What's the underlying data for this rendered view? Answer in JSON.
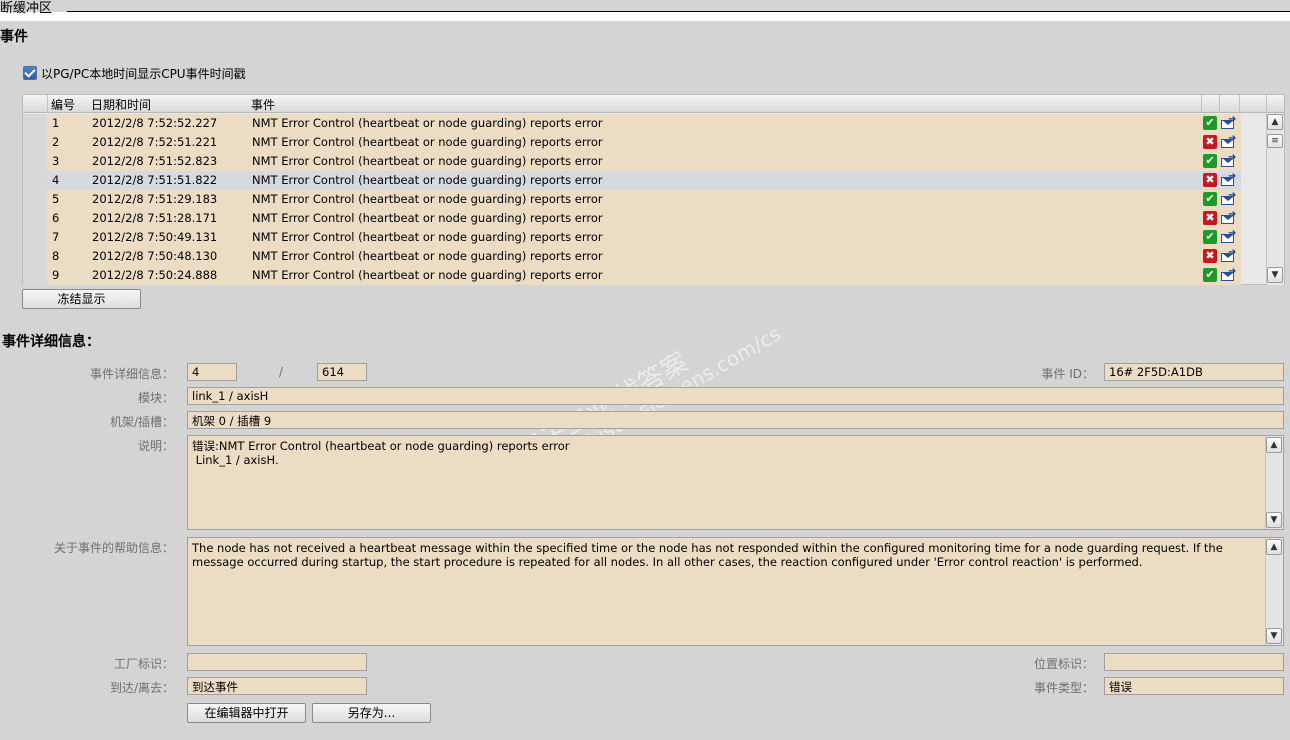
{
  "buffer": {
    "title": "断缓冲区"
  },
  "events": {
    "title": "事件",
    "checkbox_label": "以PG/PC本地时间显示CPU事件时间戳",
    "checkbox_checked": true,
    "columns": [
      "编号",
      "日期和时间",
      "事件"
    ],
    "rows": [
      {
        "no": "1",
        "time": "2012/2/8 7:52:52.227",
        "event": "NMT Error Control (heartbeat or node guarding) reports error",
        "status": "ok"
      },
      {
        "no": "2",
        "time": "2012/2/8 7:52:51.221",
        "event": "NMT Error Control (heartbeat or node guarding) reports error",
        "status": "error"
      },
      {
        "no": "3",
        "time": "2012/2/8 7:51:52.823",
        "event": "NMT Error Control (heartbeat or node guarding) reports error",
        "status": "ok"
      },
      {
        "no": "4",
        "time": "2012/2/8 7:51:51.822",
        "event": "NMT Error Control (heartbeat or node guarding) reports error",
        "status": "error"
      },
      {
        "no": "5",
        "time": "2012/2/8 7:51:29.183",
        "event": "NMT Error Control (heartbeat or node guarding) reports error",
        "status": "ok"
      },
      {
        "no": "6",
        "time": "2012/2/8 7:51:28.171",
        "event": "NMT Error Control (heartbeat or node guarding) reports error",
        "status": "error"
      },
      {
        "no": "7",
        "time": "2012/2/8 7:50:49.131",
        "event": "NMT Error Control (heartbeat or node guarding) reports error",
        "status": "ok"
      },
      {
        "no": "8",
        "time": "2012/2/8 7:50:48.130",
        "event": "NMT Error Control (heartbeat or node guarding) reports error",
        "status": "error"
      },
      {
        "no": "9",
        "time": "2012/2/8 7:50:24.888",
        "event": "NMT Error Control (heartbeat or node guarding) reports error",
        "status": "ok"
      }
    ],
    "selected_row": "4",
    "freeze_button": "冻结显示"
  },
  "details": {
    "title": "事件详细信息：",
    "labels": {
      "detail": "事件详细信息：",
      "module": "模块：",
      "rack": "机架/插槽：",
      "desc": "说明：",
      "help": "关于事件的帮助信息：",
      "plant": "工厂标识：",
      "arrive": "到达/离去：",
      "event_id": "事件 ID：",
      "location": "位置标识：",
      "event_type": "事件类型："
    },
    "detail_index": "4",
    "separator": "/",
    "detail_total": "614",
    "event_id": "16# 2F5D:A1DB",
    "module": "link_1 / axisH",
    "rack": "机架 0 / 插槽 9",
    "description": "错误:NMT Error Control (heartbeat or node guarding) reports error\n Link_1 / axisH.",
    "help": "The node has not received a heartbeat message within the specified time or the node has not responded within the configured monitoring time for a node guarding request. If the message occurred during startup, the start procedure is repeated for all nodes. In all other cases, the reaction configured under 'Error control reaction' is performed.",
    "plant": "",
    "location": "",
    "arrive": "到达事件",
    "event_type": "错误",
    "open_button": "在编辑器中打开",
    "save_button": "另存为..."
  },
  "watermark": {
    "line1": "西门子工业  找答案",
    "line2": "support.industry.siemens.com/cs"
  },
  "colors": {
    "field_bg": "#ecdcc4",
    "ok": "#1f9a2a",
    "error": "#c8171e",
    "panel": "#d4d4d4"
  }
}
